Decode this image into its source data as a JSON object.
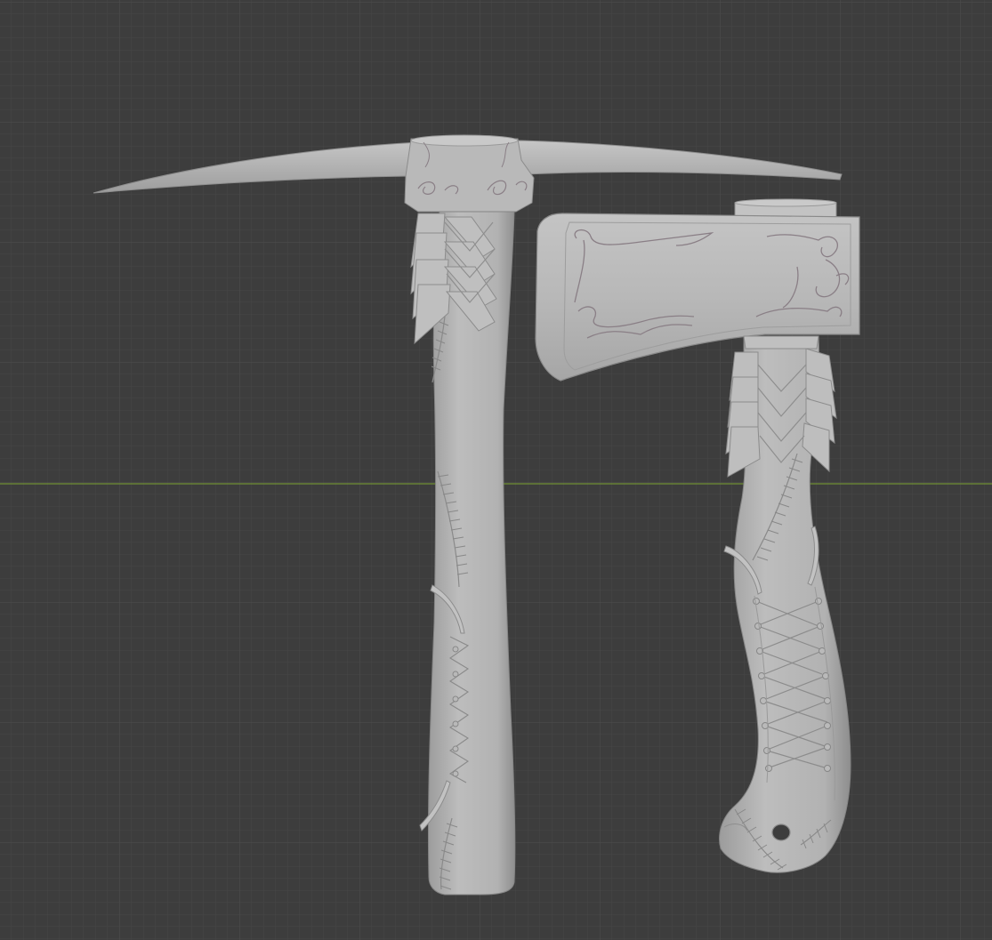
{
  "app": {
    "type": "3d-viewport",
    "view": "front-orthographic"
  },
  "viewport": {
    "background_color": "#3d3d3d",
    "grid_minor_color": "#464646",
    "grid_major_color": "#4e4e4e",
    "x_axis_color": "#6f8f34",
    "model_color": "#b5b5b5",
    "detail_line_color": "#8a7f86"
  },
  "objects": [
    {
      "name": "pickaxe",
      "icon": "pickaxe-mesh"
    },
    {
      "name": "hatchet",
      "icon": "axe-mesh"
    }
  ]
}
